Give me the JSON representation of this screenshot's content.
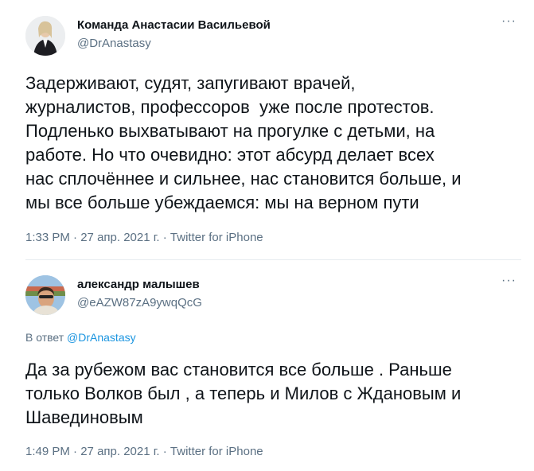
{
  "tweets": [
    {
      "author_name": "Команда Анастасии Васильевой",
      "author_handle": "@DrAnastasy",
      "more_icon": "more-horizontal-icon",
      "text": "Задерживают, судят, запугивают врачей,\nжурналистов, профессоров  уже после протестов.\nПодленько выхватывают на прогулке с детьми, на\nработе. Но что очевидно: этот абсурд делает всех\nнас сплочённее и сильнее, нас становится больше, и\nмы все больше убеждаемся: мы на верном пути",
      "time": "1:33 PM",
      "sep1": " · ",
      "date": "27 апр. 2021 г.",
      "sep2": " · ",
      "source": "Twitter for iPhone"
    },
    {
      "author_name": "александр малышев",
      "author_handle": "@eAZW87zA9ywqQcG",
      "more_icon": "more-horizontal-icon",
      "reply_prefix": "В ответ ",
      "reply_to": "@DrAnastasy",
      "text": "Да за рубежом вас становится все больше . Раньше\nтолько Волков был , а теперь и Милов с Ждановым и\nШавединовым",
      "time": "1:49 PM",
      "sep1": " · ",
      "date": "27 апр. 2021 г.",
      "sep2": " · ",
      "source": "Twitter for iPhone"
    }
  ],
  "colors": {
    "text_primary": "#0f1419",
    "text_secondary": "#5b7083",
    "link": "#1b95e0",
    "divider": "#e6ecf0"
  }
}
